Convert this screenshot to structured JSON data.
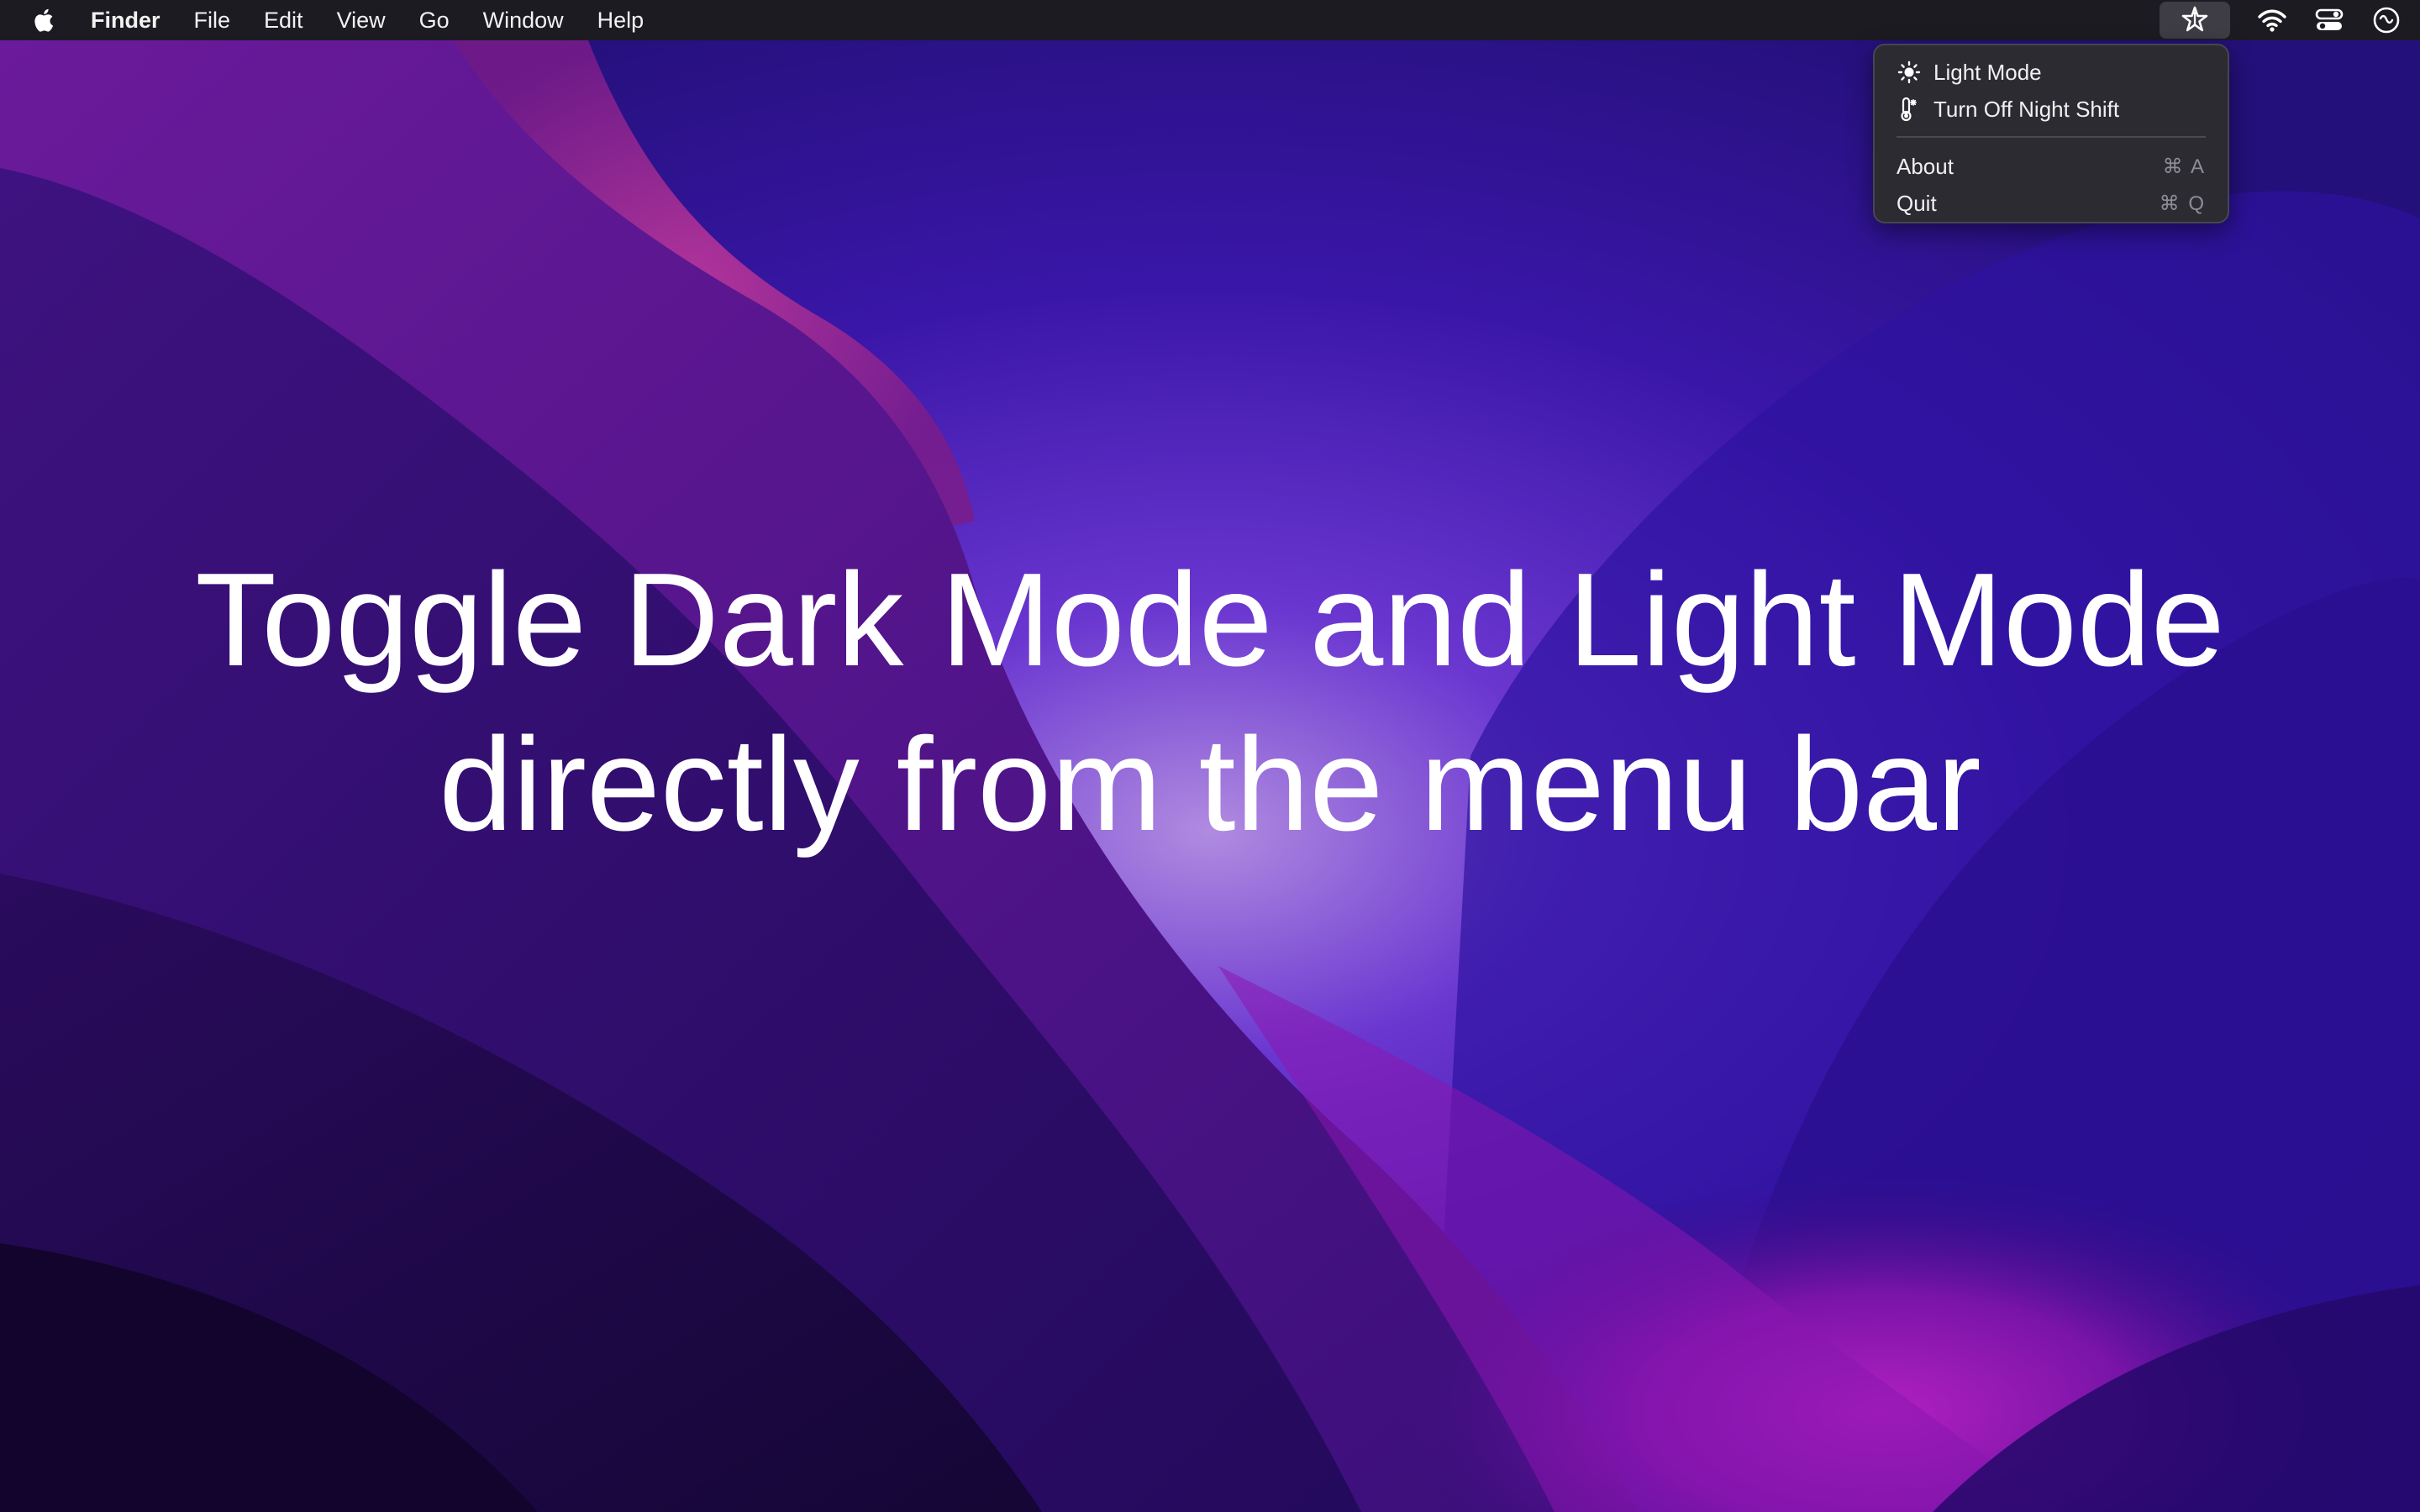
{
  "menubar": {
    "apple_icon": "apple-logo-icon",
    "app_name": "Finder",
    "menus": [
      "File",
      "Edit",
      "View",
      "Go",
      "Window",
      "Help"
    ],
    "status_icons": [
      "night-mode-star-icon",
      "wifi-icon",
      "control-center-icon",
      "siri-icon"
    ]
  },
  "dropdown": {
    "items": [
      {
        "label": "Light Mode",
        "icon": "sun-icon"
      },
      {
        "label": "Turn Off Night Shift",
        "icon": "thermometer-icon"
      }
    ],
    "actions": [
      {
        "label": "About",
        "shortcut": "⌘ A"
      },
      {
        "label": "Quit",
        "shortcut": "⌘ Q"
      }
    ]
  },
  "headline": {
    "line1": "Toggle Dark Mode and Light Mode",
    "line2": "directly from the menu bar"
  },
  "colors": {
    "menubar_bg": "#1c1b22",
    "dropdown_bg": "#2c2b32",
    "wallpaper_deep": "#1a0840",
    "wallpaper_purple": "#5a1fa8",
    "wallpaper_magenta": "#9a1fb0"
  }
}
